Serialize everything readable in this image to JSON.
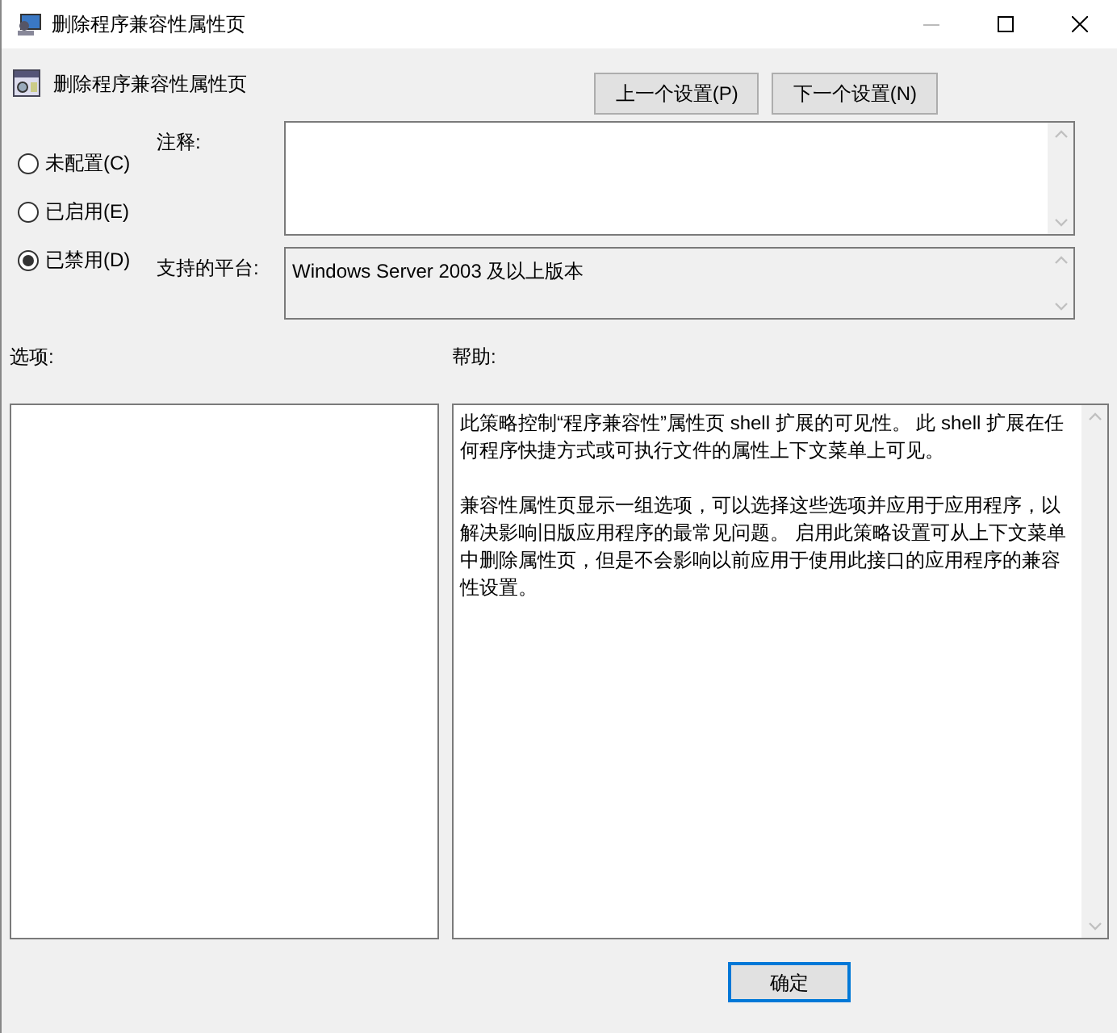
{
  "window": {
    "title": "删除程序兼容性属性页"
  },
  "header": {
    "title": "删除程序兼容性属性页"
  },
  "nav_buttons": [
    "上一个设置(P)",
    "下一个设置(N)"
  ],
  "options": [
    {
      "label": "未配置(C)",
      "selected": false
    },
    {
      "label": "已启用(E)",
      "selected": false
    },
    {
      "label": "已禁用(D)",
      "selected": true
    }
  ],
  "comment": {
    "label": "注释:"
  },
  "platform": {
    "label": "支持的平台:",
    "value": "Windows Server 2003 及以上版本"
  },
  "options_label": "选项:",
  "help": {
    "label": "帮助:",
    "paragraphs": [
      "此策略控制“程序兼容性”属性页 shell 扩展的可见性。 此 shell 扩展在任何程序快捷方式或可执行文件的属性上下文菜单上可见。",
      "兼容性属性页显示一组选项，可以选择这些选项并应用于应用程序，以解决影响旧版应用程序的最常见问题。 启用此策略设置可从上下文菜单中删除属性页，但是不会影响以前应用于使用此接口的应用程序的兼容性设置。"
    ]
  },
  "footer_buttons": [
    {
      "label": "确定",
      "kind": "default"
    }
  ]
}
